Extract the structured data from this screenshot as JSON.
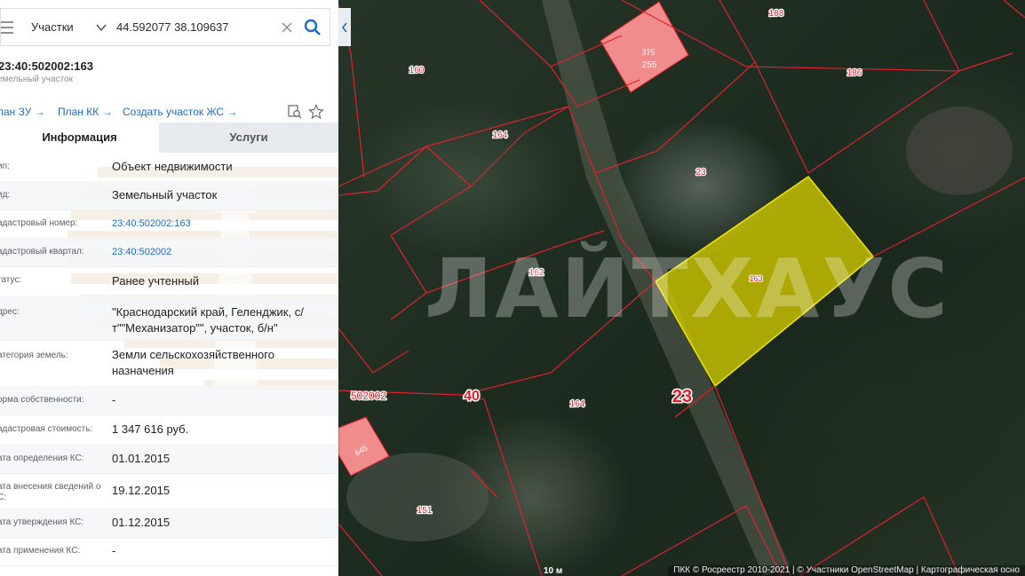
{
  "search": {
    "type_label": "Участки",
    "query": "44.592077 38.109637"
  },
  "object": {
    "cadastral_number": "23:40:502002:163",
    "object_type": "емельный участок"
  },
  "links": {
    "plan_zu": "лан ЗУ →",
    "plan_kk": "План КК →",
    "create_js": "Создать участок ЖС →"
  },
  "tabs": {
    "info": "Информация",
    "services": "Услуги"
  },
  "rows": [
    {
      "label": "ип:",
      "value": "Объект недвижимости"
    },
    {
      "label": "ид:",
      "value": "Земельный участок"
    },
    {
      "label": "адастровый номер:",
      "value": "23:40:502002:163"
    },
    {
      "label": "адастровый квартал:",
      "value": "23:40:502002"
    },
    {
      "label": "татус:",
      "value": "Ранее учтенный"
    },
    {
      "label": "дрес:",
      "value": "\"Краснодарский край, Геленджик, с/т\"\"Механизатор\"\", участок, б/н\""
    },
    {
      "label": "атегория земель:",
      "value": "Земли сельскохозяйственного назначения"
    },
    {
      "label": "орма собственности:",
      "value": "-"
    },
    {
      "label": "адастровая стоимость:",
      "value": "1 347 616 руб."
    },
    {
      "label": "ата определения КС:",
      "value": "01.01.2015"
    },
    {
      "label": "ата внесения сведений о С:",
      "value": "19.12.2015"
    },
    {
      "label": "ата утверждения КС:",
      "value": "01.12.2015"
    },
    {
      "label": "ата применения КС:",
      "value": "-"
    }
  ],
  "map": {
    "watermark": "ЛАЙТХАУС",
    "attribution": "ПКК © Росреестр 2010-2021 | © Участники OpenStreetMap | Картографическая осно",
    "scale": "10 м",
    "labels": {
      "p188": "188",
      "p375": "375",
      "p255": "255",
      "p160": "160",
      "p186": "186",
      "p164a": "164",
      "p23small": "23",
      "p162": "162",
      "p163": "163",
      "q502002": "502002",
      "q40": "40",
      "q23": "23",
      "p164b": "164",
      "p645": "645",
      "p151": "151"
    }
  },
  "colors": {
    "parcel_border": "#e0202a",
    "selected_fill": "#d4cc00",
    "pink_fill": "#f08c8c",
    "link": "#1a6fbf",
    "search_icon": "#1a6fbf"
  }
}
